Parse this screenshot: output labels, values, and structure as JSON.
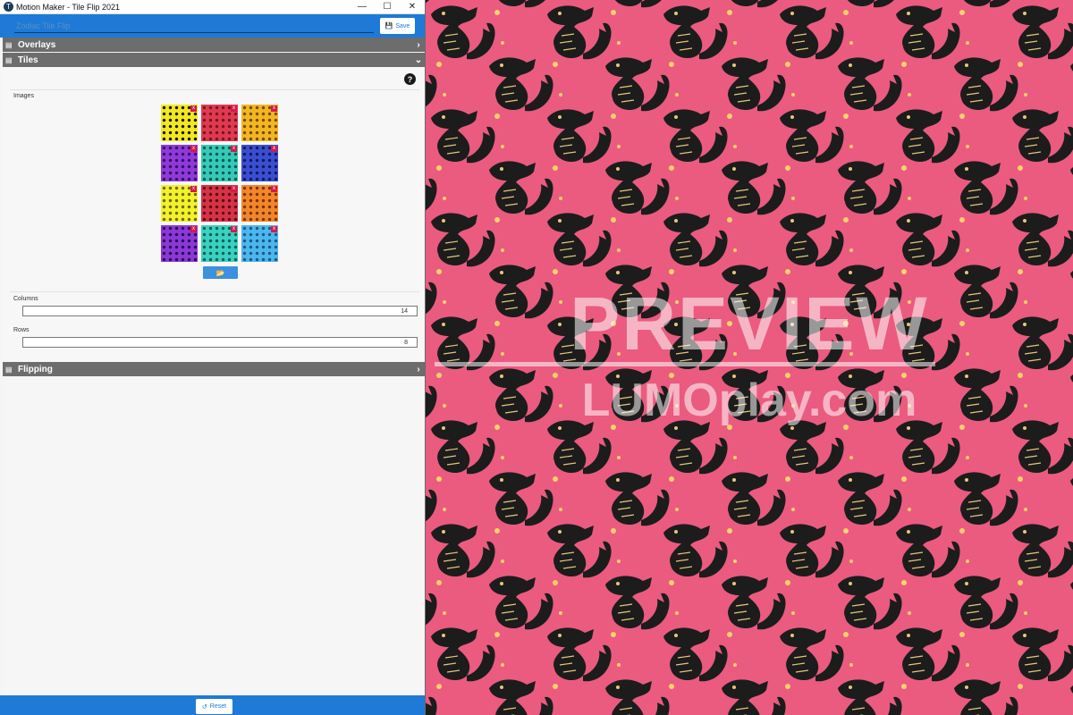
{
  "window": {
    "title": "Motion Maker - Tile Flip 2021",
    "app_icon": "T",
    "controls": [
      "minimize-icon",
      "maximize-icon",
      "close-icon"
    ]
  },
  "header": {
    "project_name": "Zodiac Tile Flip",
    "save_label": "Save",
    "accent": "#1e7ad6"
  },
  "sections": {
    "overlays": {
      "label": "Overlays",
      "expanded": false
    },
    "tiles": {
      "label": "Tiles",
      "expanded": true
    },
    "flipping": {
      "label": "Flipping",
      "expanded": false
    }
  },
  "tiles": {
    "images_label": "Images",
    "columns_label": "Columns",
    "columns_value": "14",
    "rows_label": "Rows",
    "rows_value": "8",
    "help_symbol": "?",
    "remove_symbol": "x",
    "images": [
      {
        "color": "#f3e81e",
        "dot": "#1a1a1a"
      },
      {
        "color": "#df3a50",
        "dot": "#7b1420"
      },
      {
        "color": "#f2b622",
        "dot": "#7a4a00"
      },
      {
        "color": "#8f3ad8",
        "dot": "#3a0f6a"
      },
      {
        "color": "#35c9b8",
        "dot": "#0d5a52"
      },
      {
        "color": "#3a4ed2",
        "dot": "#111a5a"
      },
      {
        "color": "#f3f12a",
        "dot": "#6a6a10"
      },
      {
        "color": "#d83246",
        "dot": "#5a0f18"
      },
      {
        "color": "#f2862a",
        "dot": "#7a3500"
      },
      {
        "color": "#8a38d6",
        "dot": "#2e0a5a"
      },
      {
        "color": "#39d1c0",
        "dot": "#0f6058"
      },
      {
        "color": "#4cb6ee",
        "dot": "#1a5a88"
      }
    ]
  },
  "footer": {
    "reset_label": "Reset"
  },
  "preview": {
    "watermark_line1": "PREVIEW",
    "watermark_line2": "LUMOplay.com",
    "background": "#ea5b7f",
    "motif": "dragon-pattern"
  }
}
